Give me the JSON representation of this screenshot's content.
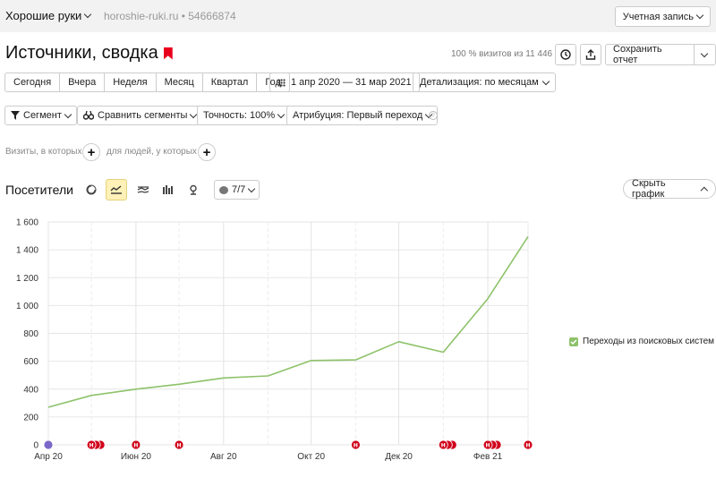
{
  "header": {
    "site_name": "Хорошие руки",
    "site_url": "horoshie-ruki.ru",
    "counter_id": "54666874",
    "account_label": "Учетная запись"
  },
  "report": {
    "title": "Источники, сводка",
    "visits_info": "100 % визитов из 11 446",
    "save_label": "Сохранить отчет"
  },
  "periods": [
    "Сегодня",
    "Вчера",
    "Неделя",
    "Месяц",
    "Квартал",
    "Год"
  ],
  "date_range": "1 апр 2020 — 31 мар 2021",
  "detail_label": "Детализация: по месяцам",
  "filters": {
    "segment": "Сегмент",
    "compare": "Сравнить сегменты",
    "accuracy": "Точность: 100%",
    "attribution": "Атрибуция: Первый переход",
    "visits_prefix": "Визиты, в которых",
    "people_prefix": "для людей, у которых"
  },
  "chart_panel": {
    "title": "Посетители",
    "comments_label": "7/7",
    "hide_label": "Скрыть график"
  },
  "chart_data": {
    "type": "line",
    "x": [
      "2020-04-01",
      "2020-05-01",
      "2020-06-01",
      "2020-07-01",
      "2020-08-01",
      "2020-09-01",
      "2020-10-01",
      "2020-11-01",
      "2020-12-01",
      "2021-01-01",
      "2021-02-01",
      "2021-03-01"
    ],
    "series": [
      {
        "name": "Переходы из поисковых систем",
        "color": "#8dc26a",
        "values": [
          270,
          355,
          400,
          435,
          480,
          495,
          605,
          610,
          740,
          665,
          1050,
          1495
        ]
      }
    ],
    "ylim": [
      0,
      1600
    ],
    "yticks": [
      0,
      200,
      400,
      600,
      800,
      1000,
      1200,
      1400,
      1600
    ],
    "ytick_labels": [
      "0",
      "200",
      "400",
      "600",
      "800",
      "1 000",
      "1 200",
      "1 400",
      "1 600"
    ],
    "xticks": [
      {
        "x": "2020-04-01",
        "label": "Апр 20"
      },
      {
        "x": "2020-06-01",
        "label": "Июн 20"
      },
      {
        "x": "2020-08-01",
        "label": "Авг 20"
      },
      {
        "x": "2020-10-01",
        "label": "Окт 20"
      },
      {
        "x": "2020-12-01",
        "label": "Дек 20"
      },
      {
        "x": "2021-02-01",
        "label": "Фев 21"
      }
    ],
    "annotation_marks": [
      {
        "x": "2020-04-01",
        "count": 1,
        "color": "#7b68c9",
        "label": ""
      },
      {
        "x": "2020-05-01",
        "count": 3,
        "color": "#d0021b",
        "label": "Н"
      },
      {
        "x": "2020-06-01",
        "count": 1,
        "color": "#d0021b",
        "label": "Н"
      },
      {
        "x": "2020-07-01",
        "count": 1,
        "color": "#d0021b",
        "label": "Н"
      },
      {
        "x": "2020-11-01",
        "count": 1,
        "color": "#d0021b",
        "label": "Н"
      },
      {
        "x": "2021-01-01",
        "count": 3,
        "color": "#d0021b",
        "label": "Н"
      },
      {
        "x": "2021-02-01",
        "count": 3,
        "color": "#d0021b",
        "label": "Н"
      },
      {
        "x": "2021-03-01",
        "count": 1,
        "color": "#d0021b",
        "label": "Н"
      }
    ],
    "grid": true,
    "legend_position": "right"
  }
}
